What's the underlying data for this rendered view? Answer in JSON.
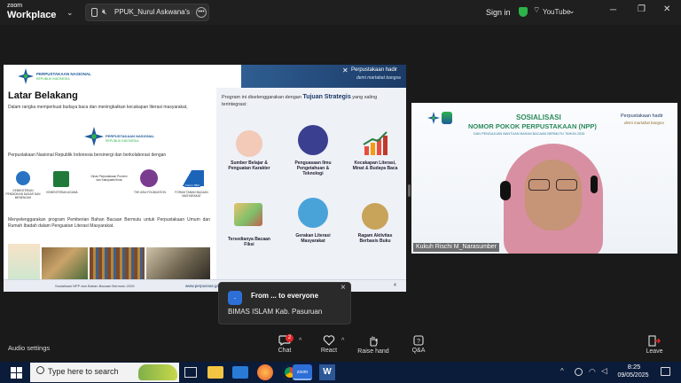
{
  "titlebar": {
    "app_small": "zoom",
    "app_name": "Workplace",
    "share_label": "PPUK_Nurul Askwana's scre",
    "signin": "Sign in",
    "youtube": "YouTube"
  },
  "slide": {
    "header_tagline_1": "Perpustakaan hadir",
    "header_tagline_2": "demi martabat bangsa",
    "header_org": "PERPUSTAKAAN NASIONAL",
    "header_org_sub": "REPUBLIK INDONESIA",
    "title": "Latar Belakang",
    "intro": "Dalam rangka memperkuat budaya baca dan meningkatkan kecakapan literasi masyarakat,",
    "center_org": "PERPUSTAKAAN NASIONAL",
    "center_org_sub": "REPUBLIK INDONESIA",
    "collab": "Perpustakaan Nasional Republik Indonesia bersinergi dan berkolaborasi dengan",
    "partners": [
      {
        "label": "KEMENTERIAN PENDIDIKAN DASAR DAN MENENGAH"
      },
      {
        "label": "KEMENTERIAN AGAMA"
      },
      {
        "label": "Dinas Perpustakaan Provinsi dan Kabupaten/Kota"
      },
      {
        "label": "THE ASIA FOUNDATION"
      },
      {
        "label": "FORUM TAMAN BACAAN MASYARAKAT"
      }
    ],
    "partner_badge": "Forum TBM",
    "program": "Menyelenggarakan program Pemberian Bahan Bacaan Bermutu untuk Perpustakaan Umum dan Rumah Ibadah dalam Penguatan Literasi Masyarakat.",
    "right_intro_1": "Program ini diselenggarakan dengan",
    "right_intro_bold": "Tujuan Strategis",
    "right_intro_2": "yang saling terintegrasi:",
    "goals": [
      {
        "label": "Sumber Belajar & Penguatan Karakter",
        "color": "#f3c9b8"
      },
      {
        "label": "Penguasaan Ilmu Pengetahuan & Teknologi",
        "color": "#3b3f8f"
      },
      {
        "label": "Kecakapan Literasi, Minat & Budaya Baca",
        "color": "#d94b3b"
      },
      {
        "label": "Tersedianya Bacaan Fiksi",
        "color": "#e0b070"
      },
      {
        "label": "Gerakan Literasi Masyarakat",
        "color": "#4aa3d8"
      },
      {
        "label": "Ragam Aktivitas Berbasis Buku",
        "color": "#c8a35a"
      }
    ],
    "footer_left": "Sosialisasi NPP dan Bahan Bacaan Bermutu 2026",
    "footer_mid": "www.perpusnas.go.id",
    "footer_right": "4"
  },
  "video": {
    "card_title_1": "SOSIALISASI",
    "card_title_2": "NOMOR POKOK PERPUSTAKAAN (NPP)",
    "card_title_3": "DAN PENGAJUAN BANTUAN BAHAN BACAAN BERMUTU TAHUN 2026",
    "card_tagline_1": "Perpustakaan hadir",
    "card_tagline_2": "demi martabat bangsa",
    "participant": "Kukuh Rischi M_Narasumber"
  },
  "chat_toast": {
    "from": "From ... to everyone",
    "message": "BIMAS ISLAM Kab. Pasuruan",
    "close": "×"
  },
  "toolbar": {
    "audio_settings": "Audio settings",
    "chat": "Chat",
    "chat_badge": "2",
    "react": "React",
    "raise_hand": "Raise hand",
    "qa": "Q&A",
    "leave": "Leave"
  },
  "taskbar": {
    "search_placeholder": "Type here to search",
    "time": "8:25",
    "date": "09/05/2025",
    "zoom_badge": "zoom",
    "word_badge": "W"
  },
  "colors": {
    "accent_green": "#2db34a",
    "leave_red": "#e02828",
    "brand_blue": "#1b3a66"
  }
}
